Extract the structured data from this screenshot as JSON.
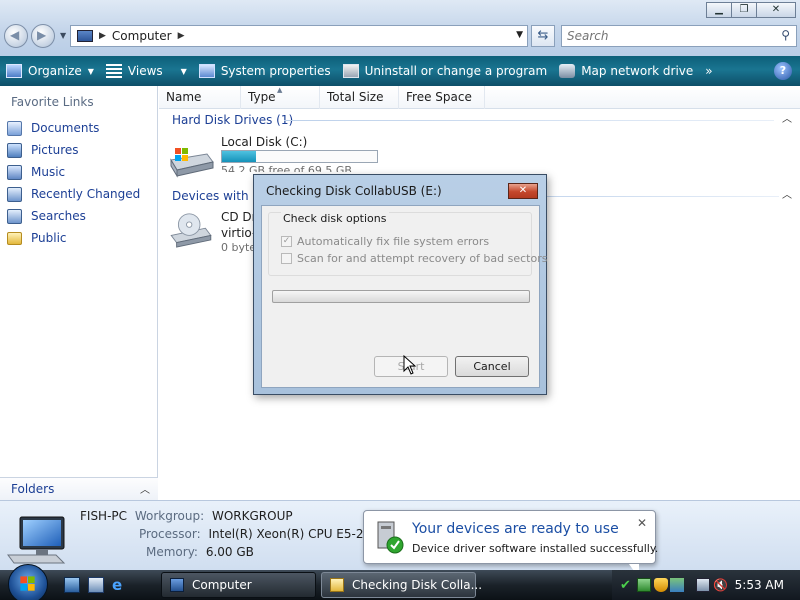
{
  "window": {
    "address": "Computer",
    "search_placeholder": "Search"
  },
  "toolbar": {
    "organize": "Organize",
    "views": "Views",
    "system_properties": "System properties",
    "uninstall": "Uninstall or change a program",
    "map_drive": "Map network drive",
    "more": "»"
  },
  "nav": {
    "header": "Favorite Links",
    "items": [
      {
        "label": "Documents",
        "icon": "documents-icon"
      },
      {
        "label": "Pictures",
        "icon": "pictures-icon"
      },
      {
        "label": "Music",
        "icon": "music-icon"
      },
      {
        "label": "Recently Changed",
        "icon": "recently-changed-icon"
      },
      {
        "label": "Searches",
        "icon": "searches-icon"
      },
      {
        "label": "Public",
        "icon": "folder-icon"
      }
    ],
    "folders": "Folders"
  },
  "columns": [
    "Name",
    "Type",
    "Total Size",
    "Free Space"
  ],
  "groups": {
    "hard_disk": "Hard Disk Drives (1)",
    "removable": "Devices with Re"
  },
  "drives": {
    "local": {
      "name": "Local Disk (C:)",
      "free": "54.2 GB free of 69.5 GB",
      "used_fraction": 0.22
    },
    "cd": {
      "name": "CD Dr",
      "line2": "virtio-",
      "line3": "0 byte"
    }
  },
  "dialog": {
    "title": "Checking Disk CollabUSB (E:)",
    "close": "✕",
    "group_label": "Check disk options",
    "option1": "Automatically fix file system errors",
    "option2": "Scan for and attempt recovery of bad sectors",
    "start": "Start",
    "cancel": "Cancel"
  },
  "details": {
    "computer_name": "FISH-PC",
    "workgroup_label": "Workgroup:",
    "workgroup": "WORKGROUP",
    "processor_label": "Processor:",
    "processor": "Intel(R) Xeon(R) CPU E5-2697 v",
    "memory_label": "Memory:",
    "memory": "6.00 GB"
  },
  "balloon": {
    "title": "Your devices are ready to use",
    "subtitle": "Device driver software installed successfully."
  },
  "taskbar": {
    "task1": "Computer",
    "task2": "Checking Disk Colla...",
    "clock": "5:53 AM"
  }
}
